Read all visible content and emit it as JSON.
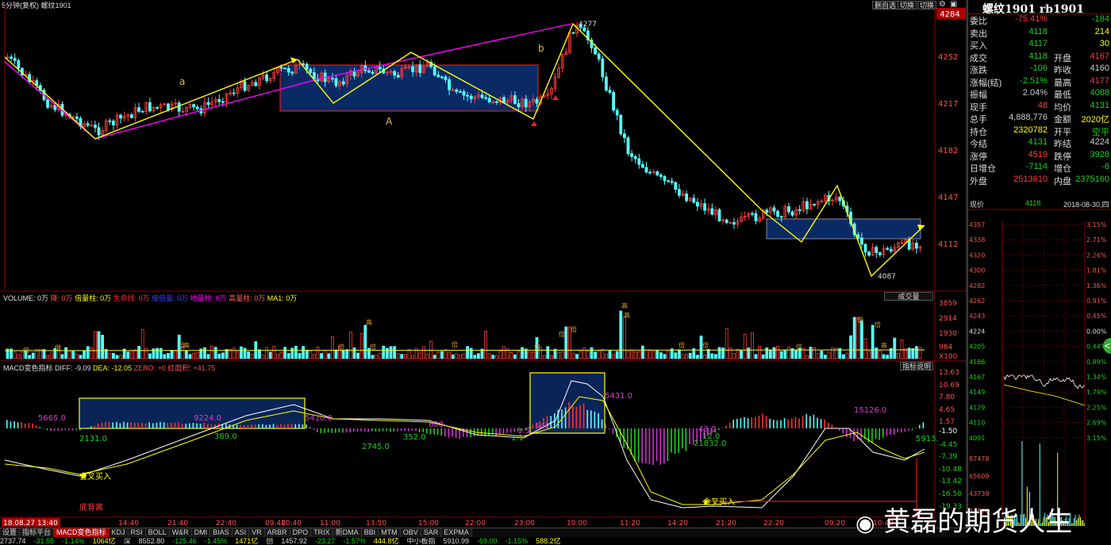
{
  "window": {
    "title": "5分钟(复权)  螺纹1901",
    "buttons": [
      "删自选",
      "切换",
      "切换"
    ]
  },
  "instrument": {
    "name": "螺纹1901 rb1901"
  },
  "main": {
    "yticks": [
      "4284",
      "4252",
      "4217",
      "4182",
      "4147",
      "4112"
    ],
    "peak_label": "4277",
    "trough_label": "4087",
    "labels": {
      "a": "a",
      "b": "b",
      "A": "A"
    }
  },
  "volume": {
    "header": [
      "VOLUME: 0万",
      "降: 0万",
      "倍量柱: 0万",
      "生命线: 0万",
      "缩倍量: 0万",
      "地量柱: 0万",
      "高量柱: 0万",
      "MA1: 0万"
    ],
    "button": "成交量",
    "yticks": [
      "3859",
      "2914",
      "1930",
      "984",
      "X100"
    ],
    "marks": [
      "高",
      "倍",
      "倍",
      "倍",
      "高",
      "高",
      "倍",
      "倍",
      "倍",
      "倍",
      "倍",
      "高",
      "倍",
      "倍",
      "倍",
      "倍",
      "高",
      "倍",
      "倍"
    ]
  },
  "macd": {
    "header": [
      "MACD变色指标",
      "DIFF: -9.09",
      "DEA: -12.05",
      "ZERO: +0",
      "红面积: +41.75"
    ],
    "button": "指标说明",
    "yticks": [
      "13.63",
      "10.69",
      "7.80",
      "4.65",
      "1.57",
      "-1.50",
      "-4.45",
      "-7.39",
      "-10.48",
      "-13.42",
      "-16.50",
      "-19.33"
    ],
    "annotations": [
      "5665.0",
      "2131.0",
      "9224.0",
      "389.0",
      "5410.0",
      "2745.0",
      "352.0",
      "608",
      "1.5",
      "542",
      "1.1",
      "5431.0",
      "21832.0",
      "12.0",
      "43.0",
      "15126.0",
      "5913."
    ],
    "markers": [
      "金叉买入",
      "金叉买入",
      "底背离"
    ]
  },
  "xaxis": {
    "ticks": [
      "18.08.27 13:40",
      "14:40",
      "21:40",
      "22:40",
      "09:40",
      "10:40",
      "11:00",
      "13:50",
      "15:00",
      "22:00",
      "23:00",
      "10:00",
      "11:20",
      "14:20",
      "21:20",
      "22:20",
      "09:20",
      "10:40"
    ]
  },
  "tabs": [
    "设置",
    "指标平台",
    "MACD变色指标",
    "KDJ",
    "RSI",
    "BOLL",
    "W&R",
    "DMI",
    "BIAS",
    "ASI",
    "VR",
    "ARBR",
    "DPO",
    "TRIX",
    "新DMA",
    "BBI",
    "MTM",
    "OBV",
    "SAR",
    "EXPMA"
  ],
  "status": [
    "2737.74",
    "-31.55",
    "-1.14%",
    "1064亿",
    "深",
    "8552.80",
    "-125.46",
    "-1.45%",
    "1471亿",
    "创",
    "1457.92",
    "-23.27",
    "-1.57%",
    "444.8亿",
    "中小板指",
    "5910.99",
    "-69.00",
    "-1.15%",
    "588.2亿"
  ],
  "quote": {
    "rows": [
      {
        "l1": "委比",
        "v1": "-75.41%",
        "c1": "#ff3b3b",
        "l2": "",
        "v2": "-184",
        "c2": "#19d219"
      },
      {
        "l1": "卖出",
        "v1": "4118",
        "c1": "#19d219",
        "l2": "",
        "v2": "214",
        "c2": "#ffff00"
      },
      {
        "l1": "买入",
        "v1": "4117",
        "c1": "#19d219",
        "l2": "",
        "v2": "30",
        "c2": "#ffff00"
      },
      {
        "l1": "成交",
        "v1": "4118",
        "c1": "#19d219",
        "l2": "开盘",
        "v2": "4167",
        "c2": "#ff3b3b"
      },
      {
        "l1": "涨跌",
        "v1": "-106",
        "c1": "#19d219",
        "l2": "昨收",
        "v2": "4160",
        "c2": "#cccccc"
      },
      {
        "l1": "涨幅(结)",
        "v1": "-2.51%",
        "c1": "#19d219",
        "l2": "最高",
        "v2": "4177",
        "c2": "#ff3b3b"
      },
      {
        "l1": "振幅",
        "v1": "2.04%",
        "c1": "#cccccc",
        "l2": "最低",
        "v2": "4088",
        "c2": "#19d219"
      },
      {
        "l1": "现手",
        "v1": "48",
        "c1": "#ff3b3b",
        "l2": "均价",
        "v2": "4131",
        "c2": "#19d219"
      },
      {
        "l1": "总手",
        "v1": "4,888,776",
        "c1": "#cccccc",
        "l2": "金额",
        "v2": "2020亿",
        "c2": "#ffff00"
      },
      {
        "l1": "持仓",
        "v1": "2320782",
        "c1": "#ffff00",
        "l2": "开平",
        "v2": "空平",
        "c2": "#19d219"
      },
      {
        "l1": "今结",
        "v1": "4131",
        "c1": "#19d219",
        "l2": "昨结",
        "v2": "4224",
        "c2": "#cccccc"
      },
      {
        "l1": "涨停",
        "v1": "4519",
        "c1": "#ff3b3b",
        "l2": "跌停",
        "v2": "3928",
        "c2": "#19d219"
      },
      {
        "l1": "日增仓",
        "v1": "-7114",
        "c1": "#19d219",
        "l2": "增仓",
        "v2": "-6",
        "c2": "#19d219"
      },
      {
        "l1": "外盘",
        "v1": "2513610",
        "c1": "#ff3b3b",
        "l2": "内盘",
        "v2": "2375160",
        "c2": "#19d219"
      }
    ],
    "current_label": "现价",
    "current_value": "4118",
    "date": "2018-08-30,四"
  },
  "intraday": {
    "yleft": [
      "4357",
      "4338",
      "4320",
      "4300",
      "4282",
      "4262",
      "4243",
      "4224",
      "4205",
      "4186",
      "4167",
      "4149",
      "4129",
      "4110",
      "4091"
    ],
    "yright": [
      "3.15%",
      "2.71%",
      "2.26%",
      "1.81%",
      "1.36%",
      "0.91%",
      "0.45%",
      "0.00%",
      "0.44%",
      "0.89%",
      "1.34%",
      "1.79%",
      "2.25%",
      "2.69%",
      "3.15%"
    ],
    "vol_ticks": [
      "87478",
      "65609",
      "43739",
      "21870"
    ]
  },
  "watermark": "黄磊的期货人生",
  "colors": {
    "up": "#ff3b3b",
    "down": "#54ffff",
    "trend": "#ffff00",
    "ma": "#ff00ff",
    "box": "#0a2a66"
  }
}
